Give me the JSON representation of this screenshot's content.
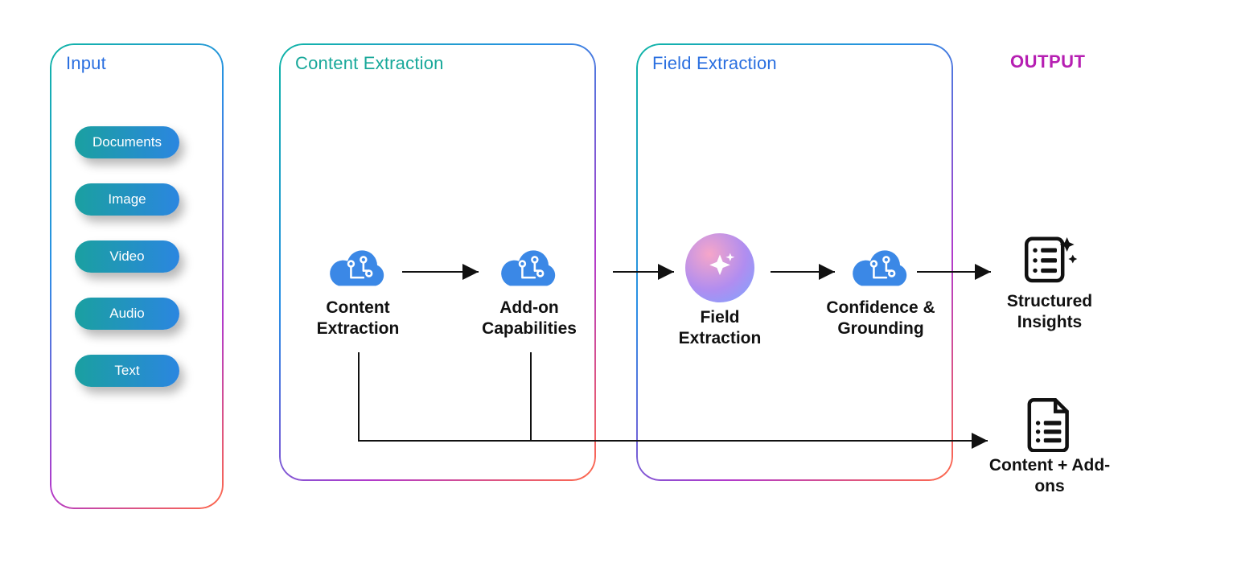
{
  "input": {
    "title": "Input",
    "title_color": "#2a6fe0",
    "pills": [
      "Documents",
      "Image",
      "Video",
      "Audio",
      "Text"
    ]
  },
  "content_extraction": {
    "title": "Content Extraction",
    "title_color": "#18a89a",
    "nodes": {
      "ce": "Content Extraction",
      "addon": "Add-on Capabilities"
    }
  },
  "field_extraction": {
    "title": "Field Extraction",
    "title_color": "#2a6fe0",
    "nodes": {
      "fe": "Field Extraction",
      "cg": "Confidence & Grounding"
    }
  },
  "output": {
    "title": "OUTPUT",
    "title_color": "#b61fb2",
    "structured": "Structured Insights",
    "content_addons": "Content + Add-ons"
  }
}
